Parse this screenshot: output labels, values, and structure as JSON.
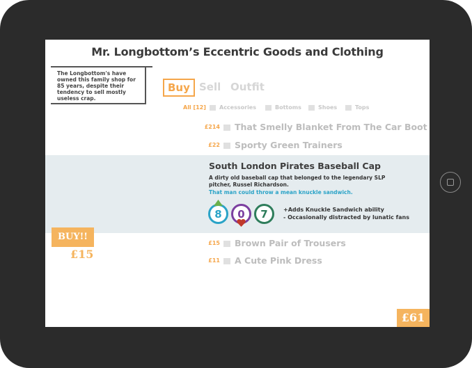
{
  "shop": {
    "title": "Mr. Longbottom’s Eccentric Goods and Clothing",
    "about": "The Longbottom's have owned this family shop for 85 years, despite their tendency to sell mostly useless crap."
  },
  "tabs": [
    {
      "label": "Buy",
      "active": true
    },
    {
      "label": "Sell",
      "active": false
    },
    {
      "label": "Outfit",
      "active": false
    }
  ],
  "filters": {
    "all": "All [12]",
    "categories": [
      "Accessories",
      "Bottoms",
      "Shoes",
      "Tops"
    ]
  },
  "items": [
    {
      "price": "£214",
      "name": "That Smelly Blanket From The Car Boot"
    },
    {
      "price": "£22",
      "name": "Sporty Green Trainers"
    },
    {
      "price": "£15",
      "name": "Brown Pair of Trousers"
    },
    {
      "price": "£11",
      "name": "A Cute Pink Dress"
    }
  ],
  "selected": {
    "name": "South London Pirates Baseball Cap",
    "description": "A dirty old baseball cap that belonged to the legendary SLP pitcher, Russel Richardson.",
    "quote": "That man could throw a mean knuckle sandwich.",
    "stats": [
      {
        "value": "8",
        "color": "#2aa3c7",
        "indicator": "up-arrow-icon",
        "indicator_color": "#6ab04c"
      },
      {
        "value": "0",
        "color": "#7b3fa0",
        "indicator": "heart-icon",
        "indicator_color": "#c0392b"
      },
      {
        "value": "7",
        "color": "#2e7d5b",
        "indicator": null
      }
    ],
    "effects": [
      "+Adds Knuckle Sandwich ability",
      "- Occasionally distracted by lunatic fans"
    ]
  },
  "buy": {
    "label": "BUY!!",
    "price": "£15"
  },
  "wallet": {
    "total": "£61"
  },
  "colors": {
    "accent": "#f5a64a",
    "highlight_bg": "#e5ecef",
    "quote": "#2aa3c7"
  }
}
